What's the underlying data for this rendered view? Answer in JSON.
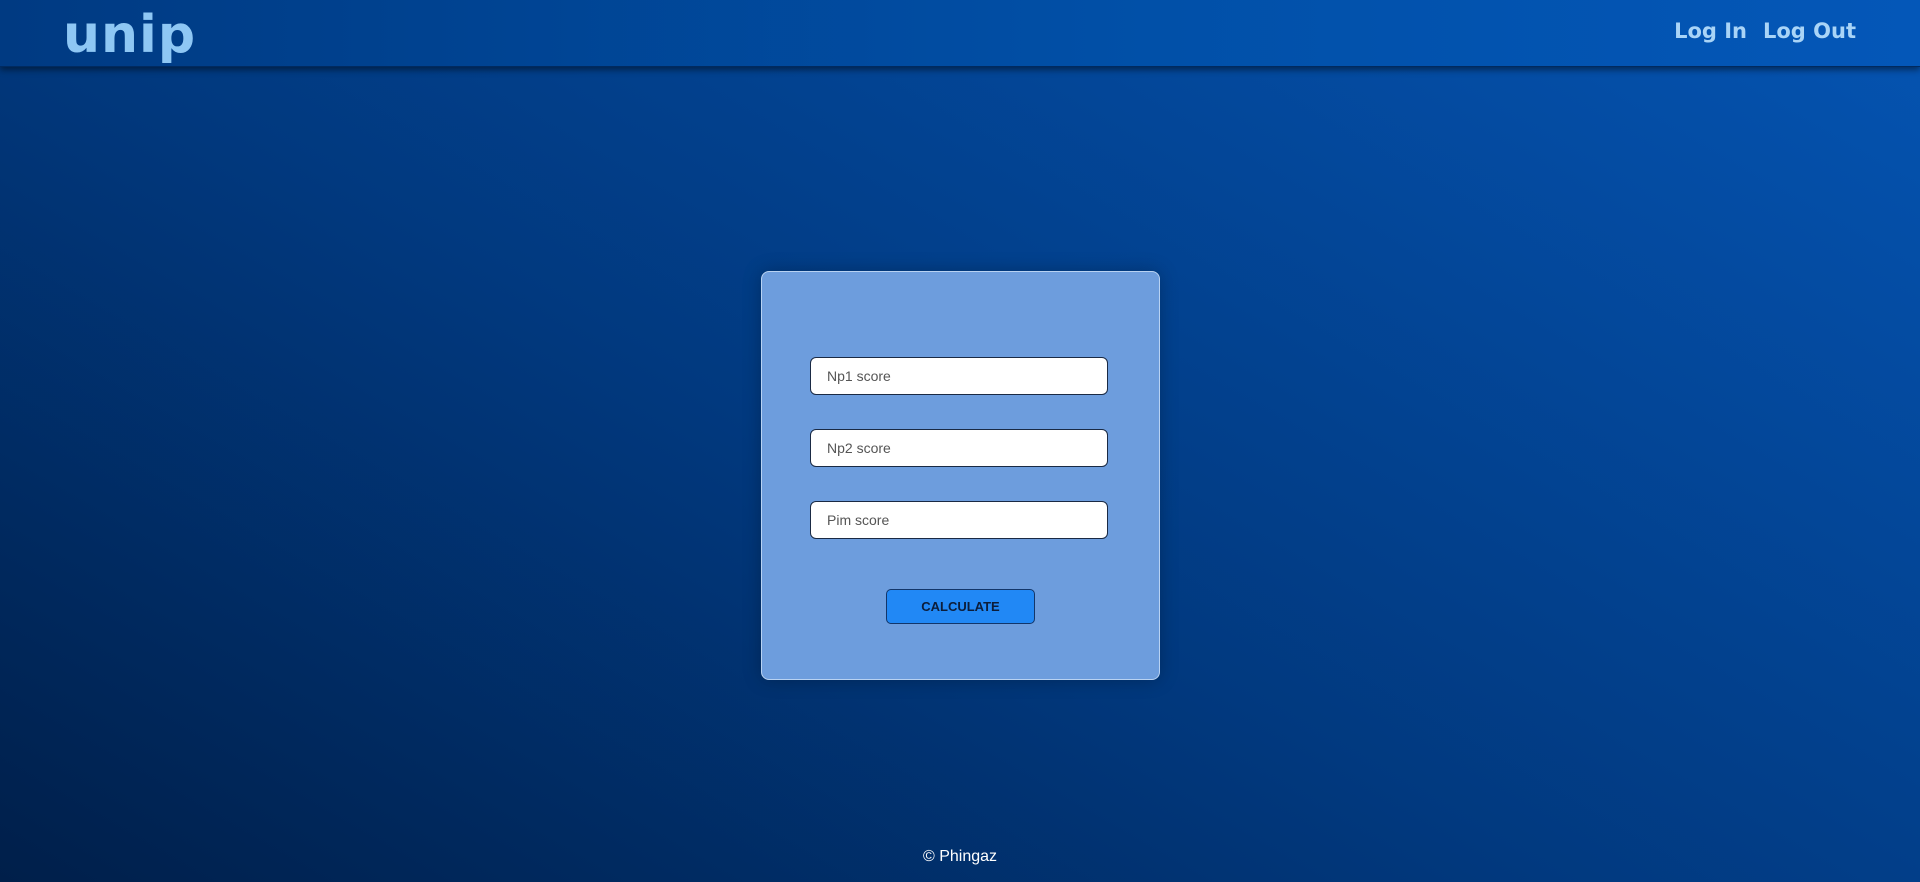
{
  "header": {
    "logo": "unip",
    "nav": [
      {
        "label": "Log In"
      },
      {
        "label": "Log Out"
      }
    ]
  },
  "form": {
    "np1_placeholder": "Np1 score",
    "np2_placeholder": "Np2 score",
    "pim_placeholder": "Pim score",
    "np1_value": "",
    "np2_value": "",
    "pim_value": "",
    "calculate_label": "CALCULATE"
  },
  "footer": {
    "text": "© Phingaz"
  },
  "colors": {
    "logo": "#8ec7f4",
    "nav_link": "#a9d4f7",
    "card_bg": "#6d9ddd",
    "button_bg": "#2188f5"
  }
}
